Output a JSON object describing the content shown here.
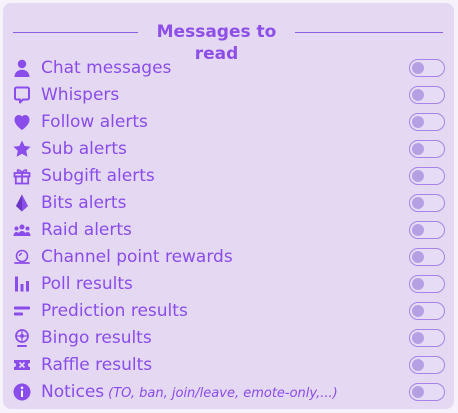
{
  "panel": {
    "title": "Messages to read",
    "items": [
      {
        "label": "Chat messages",
        "icon": "user-icon",
        "enabled": false
      },
      {
        "label": "Whispers",
        "icon": "speech-bubble-icon",
        "enabled": false
      },
      {
        "label": "Follow alerts",
        "icon": "heart-icon",
        "enabled": false
      },
      {
        "label": "Sub alerts",
        "icon": "star-icon",
        "enabled": false
      },
      {
        "label": "Subgift alerts",
        "icon": "gift-icon",
        "enabled": false
      },
      {
        "label": "Bits alerts",
        "icon": "bits-gem-icon",
        "enabled": false
      },
      {
        "label": "Raid alerts",
        "icon": "raid-group-icon",
        "enabled": false
      },
      {
        "label": "Channel point rewards",
        "icon": "channel-points-icon",
        "enabled": false
      },
      {
        "label": "Poll results",
        "icon": "bar-chart-icon",
        "enabled": false
      },
      {
        "label": "Prediction results",
        "icon": "prediction-bars-icon",
        "enabled": false
      },
      {
        "label": "Bingo results",
        "icon": "bingo-cage-icon",
        "enabled": false
      },
      {
        "label": "Raffle results",
        "icon": "ticket-icon",
        "enabled": false
      },
      {
        "label": "Notices",
        "sub": "(TO, ban, join/leave, emote-only,...)",
        "icon": "info-icon",
        "enabled": false
      }
    ]
  },
  "colors": {
    "accent": "#8a4cea",
    "panel_bg": "#e4d8f3",
    "toggle_border": "#a784e8",
    "toggle_knob": "#b5a0e4"
  }
}
